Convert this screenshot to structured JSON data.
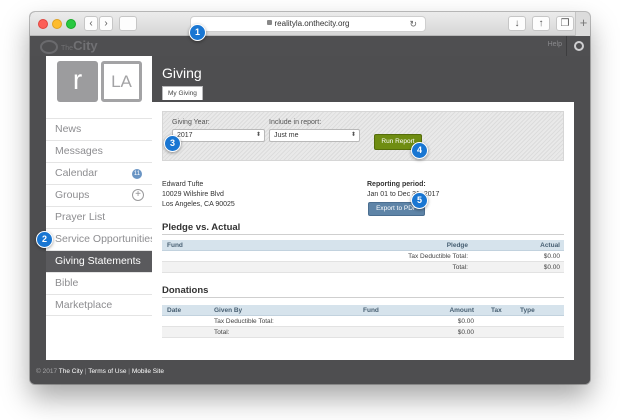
{
  "browser": {
    "url": "realityla.onthecity.org",
    "back_glyph": "‹",
    "forward_glyph": "›",
    "plus_glyph": "+"
  },
  "appbar": {
    "logo_the": "The",
    "logo_city": "City",
    "help": "Help"
  },
  "sidebar": {
    "logo_left": "r",
    "logo_right": "LA",
    "items": [
      {
        "label": "News"
      },
      {
        "label": "Messages"
      },
      {
        "label": "Calendar",
        "badge": "11"
      },
      {
        "label": "Groups",
        "action": "+"
      },
      {
        "label": "Prayer List"
      },
      {
        "label": "Service Opportunities"
      },
      {
        "label": "Giving Statements",
        "active": true
      },
      {
        "label": "Bible"
      },
      {
        "label": "Marketplace"
      }
    ]
  },
  "main": {
    "title": "Giving",
    "tab": "My Giving",
    "filter": {
      "year_label": "Giving Year:",
      "year_value": "2017",
      "include_label": "Include in report:",
      "include_value": "Just me",
      "run_button": "Run Report"
    },
    "address": {
      "name": "Edward Tufte",
      "street": "10029 Wilshire Blvd",
      "city": "Los Angeles, CA 90025"
    },
    "period": {
      "label": "Reporting period:",
      "value": "Jan 01 to Dec 31, 2017"
    },
    "export_button": "Export to PDF",
    "pledge": {
      "heading": "Pledge vs. Actual",
      "columns": [
        "Fund",
        "Pledge",
        "Actual"
      ],
      "rows": [
        {
          "label": "Tax Deductible Total:",
          "actual": "$0.00"
        },
        {
          "label": "Total:",
          "actual": "$0.00"
        }
      ]
    },
    "donations": {
      "heading": "Donations",
      "columns": [
        "Date",
        "Given By",
        "Fund",
        "Amount",
        "Tax",
        "Type"
      ],
      "rows": [
        {
          "label": "Tax Deductible Total:",
          "amount": "$0.00"
        },
        {
          "label": "Total:",
          "amount": "$0.00"
        }
      ]
    }
  },
  "footer": {
    "copyright": "© 2017",
    "links": [
      "The City",
      "Terms of Use",
      "Mobile Site"
    ],
    "separator": "|"
  },
  "callouts": [
    "1",
    "2",
    "3",
    "4",
    "5"
  ],
  "colors": {
    "callout": "#1976d2",
    "run_button": "#6f8d12",
    "export_button": "#5e84a7",
    "table_header": "#d6e3ec",
    "active_nav": "#5a5a5d"
  }
}
